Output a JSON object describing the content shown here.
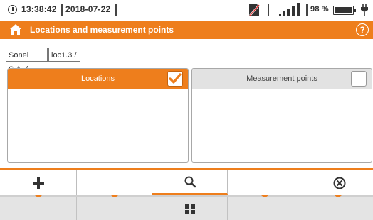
{
  "status": {
    "time": "13:38:42",
    "date": "2018-07-22",
    "battery_percent": "98 %",
    "signal_bars": 4
  },
  "header": {
    "title": "Locations and measurement points"
  },
  "breadcrumb": [
    "Sonel S.A. /",
    "loc1.3 /"
  ],
  "panels": {
    "locations": {
      "label": "Locations",
      "checked": true
    },
    "points": {
      "label": "Measurement points",
      "checked": false
    }
  },
  "toolbar": {
    "buttons": [
      "add-icon",
      "",
      "search-icon",
      "",
      "close-circle-icon"
    ],
    "row2": [
      "",
      "",
      "grid-icon",
      "",
      ""
    ]
  },
  "colors": {
    "accent": "#ee7e1c"
  }
}
